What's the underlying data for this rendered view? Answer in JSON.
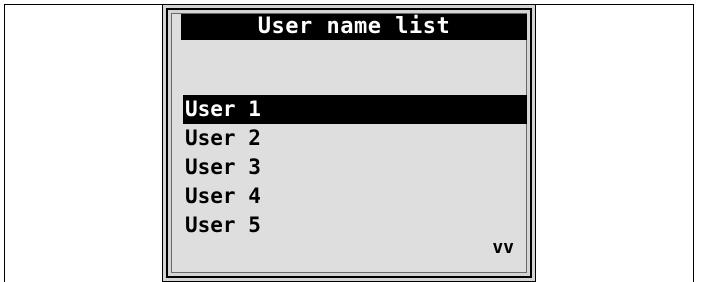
{
  "screen": {
    "title": "User name list",
    "users": [
      {
        "label": "User 1",
        "selected": true
      },
      {
        "label": "User 2",
        "selected": false
      },
      {
        "label": "User 3",
        "selected": false
      },
      {
        "label": "User 4",
        "selected": false
      },
      {
        "label": "User 5",
        "selected": false
      }
    ],
    "scroll_indicator": "vv"
  },
  "colors": {
    "screen_background": "#dedede",
    "bezel": "#d4d4d4",
    "highlight": "#000000",
    "highlight_text": "#ffffff"
  }
}
